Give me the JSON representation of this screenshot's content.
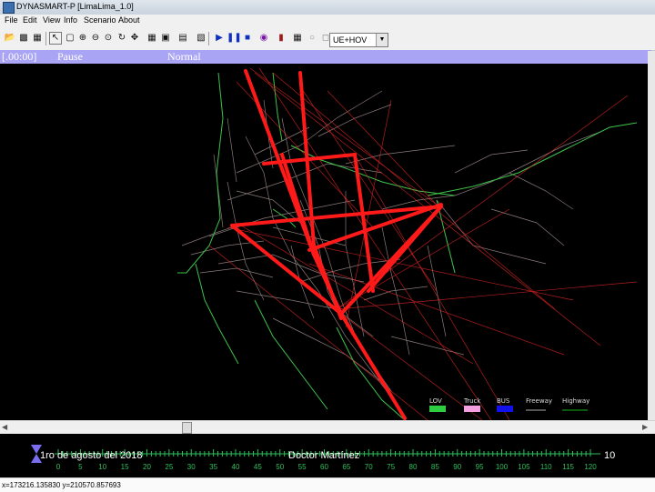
{
  "window": {
    "title": "DYNASMART-P  [LimaLima_1.0]"
  },
  "menu": [
    "File",
    "Edit",
    "View",
    "Info",
    "Scenario",
    "About"
  ],
  "toolbar": {
    "mode_select": "UE+HOV",
    "icons": [
      "open-folder",
      "save",
      "save-as",
      "pointer",
      "select",
      "zoom-in",
      "zoom-out",
      "zoom-fit",
      "refresh",
      "move-object",
      "grid",
      "edit-node",
      "edit-link",
      "play",
      "pause",
      "stop",
      "record",
      "chart",
      "lock",
      "step"
    ]
  },
  "sim_status": {
    "time": "[.00:00]",
    "state": "Pause",
    "mode": "Normal"
  },
  "map": {
    "legend": [
      {
        "label": "LOV",
        "color": "#2ecc40"
      },
      {
        "label": "Truck",
        "color": "#f4a0e0"
      },
      {
        "label": "BUS",
        "color": "#1111ee"
      },
      {
        "label": "Freeway",
        "color": "#555555"
      },
      {
        "label": "Highway",
        "color": "#0a5a0a"
      }
    ],
    "colors": {
      "od_flow": "#ff1a1a",
      "streets": "#b9a2a2",
      "arterials": "#3ec24a",
      "background": "#000000"
    }
  },
  "timeline": {
    "date": "1ro de agosto del 2018",
    "author": "Doctor Martínez",
    "page": "10",
    "ticks": [
      "0",
      "5",
      "10",
      "15",
      "20",
      "25",
      "30",
      "35",
      "40",
      "45",
      "50",
      "55",
      "60",
      "65",
      "70",
      "75",
      "80",
      "85",
      "90",
      "95",
      "100",
      "105",
      "110",
      "115",
      "120"
    ]
  },
  "coords": "x=173216.135830 y=210570.857693"
}
